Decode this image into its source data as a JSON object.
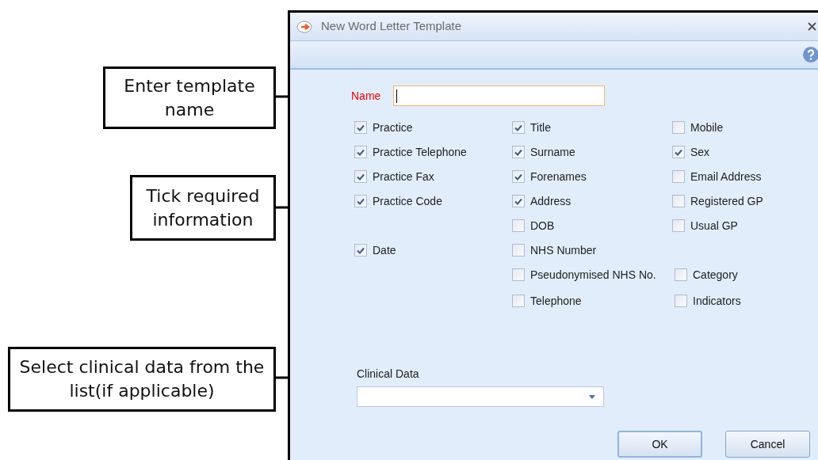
{
  "callouts": [
    {
      "text": "Enter template name"
    },
    {
      "text": "Tick required information"
    },
    {
      "text": "Select clinical data from the list(if applicable)"
    }
  ],
  "dialog": {
    "title": "New Word Letter Template",
    "name_field": {
      "label": "Name"
    },
    "fields": [
      [
        {
          "label": "Practice",
          "checked": true
        },
        {
          "label": "Practice Telephone",
          "checked": true
        },
        {
          "label": "Practice Fax",
          "checked": true
        },
        {
          "label": "Practice Code",
          "checked": true
        },
        {
          "label": "Date",
          "checked": true
        }
      ],
      [
        {
          "label": "Title",
          "checked": true
        },
        {
          "label": "Surname",
          "checked": true
        },
        {
          "label": "Forenames",
          "checked": true
        },
        {
          "label": "Address",
          "checked": true
        },
        {
          "label": "DOB",
          "checked": false
        },
        {
          "label": "NHS Number",
          "checked": false
        },
        {
          "label": "Pseudonymised NHS No.",
          "checked": false
        },
        {
          "label": "Telephone",
          "checked": false
        }
      ],
      [
        {
          "label": "Mobile",
          "checked": false
        },
        {
          "label": "Sex",
          "checked": true
        },
        {
          "label": "Email Address",
          "checked": false
        },
        {
          "label": "Registered GP",
          "checked": false
        },
        {
          "label": "Usual GP",
          "checked": false
        },
        {
          "label": "Category",
          "checked": false
        },
        {
          "label": "Indicators",
          "checked": false
        }
      ]
    ],
    "clinical_data": {
      "label": "Clinical Data"
    },
    "buttons": [
      "OK",
      "Cancel"
    ]
  }
}
